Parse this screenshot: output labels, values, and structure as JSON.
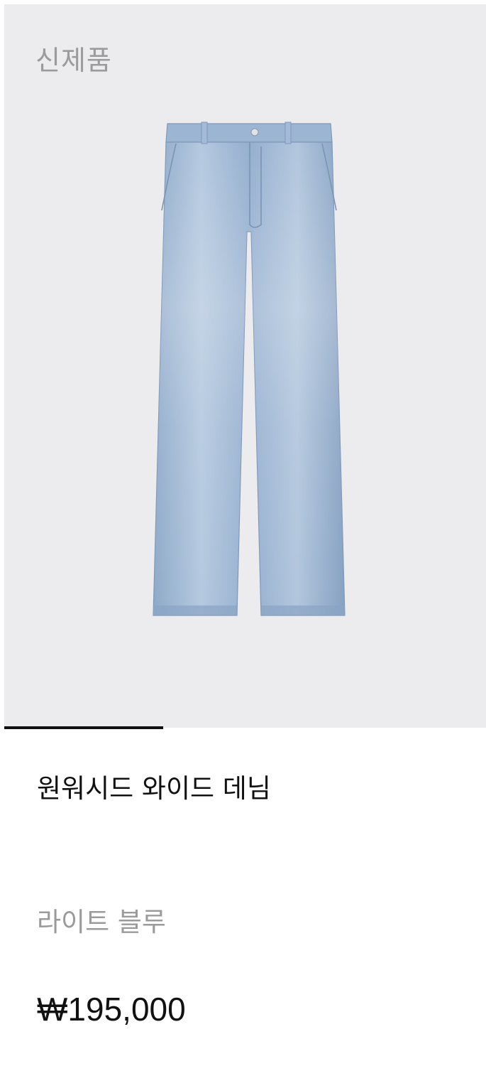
{
  "product": {
    "badge": "신제품",
    "image": {
      "icon": "wide-leg-jeans-photo",
      "denim_color": "#9fb8d6",
      "background": "#ececee"
    },
    "carousel": {
      "progress": 0.33,
      "indicator_color": "#111111"
    },
    "name": "원워시드 와이드 데님",
    "color": "라이트 블루",
    "price": "₩195,000"
  }
}
